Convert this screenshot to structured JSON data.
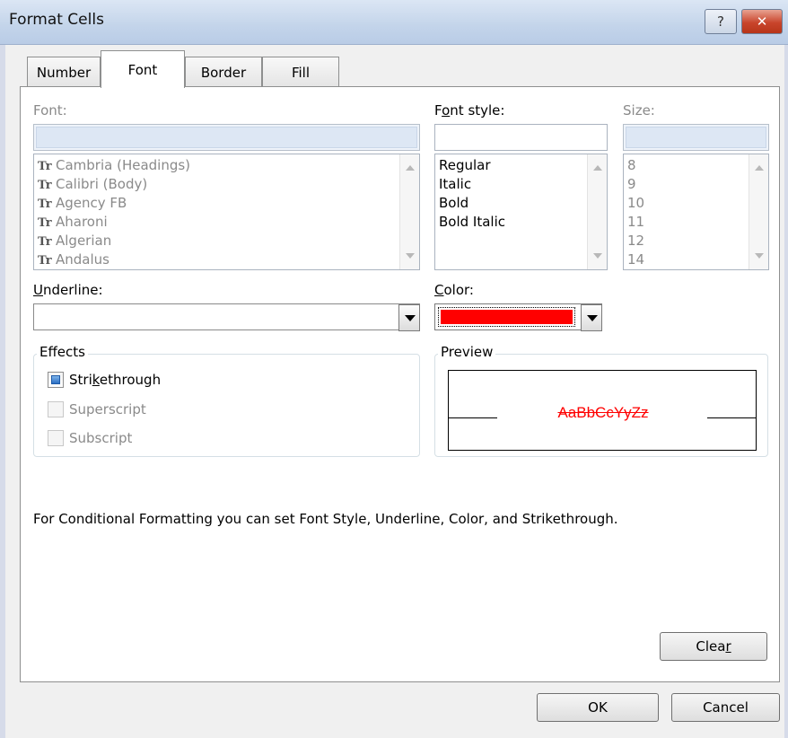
{
  "window": {
    "title": "Format Cells",
    "help_label": "?",
    "close_label": "✕"
  },
  "tabs": [
    {
      "label": "Number",
      "active": false
    },
    {
      "label": "Font",
      "active": true
    },
    {
      "label": "Border",
      "active": false
    },
    {
      "label": "Fill",
      "active": false
    }
  ],
  "font": {
    "label": "Font:",
    "value": "",
    "items": [
      "Cambria (Headings)",
      "Calibri (Body)",
      "Agency FB",
      "Aharoni",
      "Algerian",
      "Andalus"
    ]
  },
  "font_style": {
    "label_prefix": "F",
    "label_u": "o",
    "label_rest": "nt style:",
    "value": "",
    "items": [
      "Regular",
      "Italic",
      "Bold",
      "Bold Italic"
    ]
  },
  "size": {
    "label": "Size:",
    "value": "",
    "items": [
      "8",
      "9",
      "10",
      "11",
      "12",
      "14"
    ]
  },
  "underline": {
    "label_u": "U",
    "label_rest": "nderline:",
    "value": ""
  },
  "color": {
    "label_u": "C",
    "label_rest": "olor:",
    "value": "#ff0000"
  },
  "effects": {
    "title": "Effects",
    "strikethrough": {
      "pre": "Stri",
      "u": "k",
      "post": "ethrough",
      "checked": true,
      "enabled": true
    },
    "superscript": {
      "label": "Superscript",
      "checked": false,
      "enabled": false
    },
    "subscript": {
      "label": "Subscript",
      "checked": false,
      "enabled": false
    }
  },
  "preview": {
    "title": "Preview",
    "sample_text": "AaBbCcYyZz",
    "color": "#ff0000"
  },
  "info_text": "For Conditional Formatting you can set Font Style, Underline, Color, and Strikethrough.",
  "buttons": {
    "clear_pre": "Clea",
    "clear_u": "r",
    "ok": "OK",
    "cancel": "Cancel"
  }
}
